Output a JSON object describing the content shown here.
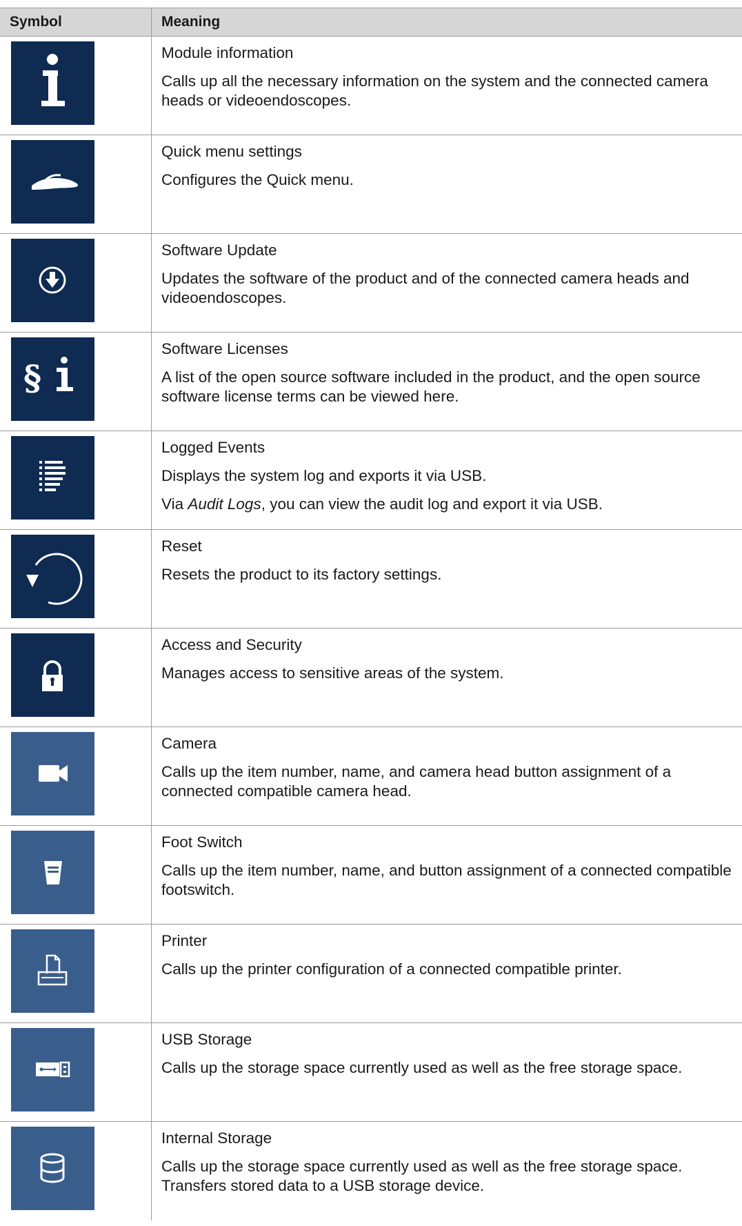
{
  "table": {
    "header": {
      "symbol": "Symbol",
      "meaning": "Meaning"
    },
    "rows": [
      {
        "icon": "info-icon",
        "icon_bg": "#0f2b52",
        "title": "Module information",
        "lines": [
          "Calls up all the necessary information on the system and the connected camera heads or videoendoscopes."
        ]
      },
      {
        "icon": "hand-icon",
        "icon_bg": "#0f2b52",
        "title": "Quick menu settings",
        "lines": [
          "Configures the Quick menu."
        ]
      },
      {
        "icon": "download-circle-icon",
        "icon_bg": "#0f2b52",
        "title": "Software Update",
        "lines": [
          "Updates the software of the product and of the connected camera heads and videoendoscopes."
        ]
      },
      {
        "icon": "license-icon",
        "icon_bg": "#0f2b52",
        "title": "Software Licenses",
        "lines": [
          "A list of the open source software included in the product, and the open source software license terms can be viewed here."
        ]
      },
      {
        "icon": "list-icon",
        "icon_bg": "#0f2b52",
        "title": "Logged Events",
        "lines": [
          "Displays the system log and exports it via USB."
        ],
        "extra_prefix": "Via ",
        "extra_italic": "Audit Logs",
        "extra_suffix": ", you can view the audit log and export it via USB."
      },
      {
        "icon": "reset-icon",
        "icon_bg": "#0f2b52",
        "title": "Reset",
        "lines": [
          "Resets the product to its factory settings."
        ]
      },
      {
        "icon": "lock-icon",
        "icon_bg": "#0f2b52",
        "title": "Access and Security",
        "lines": [
          "Manages access to sensitive areas of the system."
        ]
      },
      {
        "icon": "camera-icon",
        "icon_bg": "#3a5e8c",
        "title": "Camera",
        "lines": [
          "Calls up the item number, name, and camera head button assignment of a connected compatible camera head."
        ]
      },
      {
        "icon": "foot-switch-icon",
        "icon_bg": "#3a5e8c",
        "title": "Foot Switch",
        "lines": [
          "Calls up the item number, name, and button assignment of a connected compatible footswitch."
        ]
      },
      {
        "icon": "printer-icon",
        "icon_bg": "#3a5e8c",
        "title": "Printer",
        "lines": [
          "Calls up the printer configuration of a connected compatible printer."
        ]
      },
      {
        "icon": "usb-icon",
        "icon_bg": "#3a5e8c",
        "title": "USB Storage",
        "lines": [
          "Calls up the storage space currently used as well as the free storage space."
        ]
      },
      {
        "icon": "database-icon",
        "icon_bg": "#3a5e8c",
        "title": "Internal Storage",
        "lines": [
          "Calls up the storage space currently used as well as the free storage space. Transfers stored data to a USB storage device."
        ]
      }
    ]
  }
}
